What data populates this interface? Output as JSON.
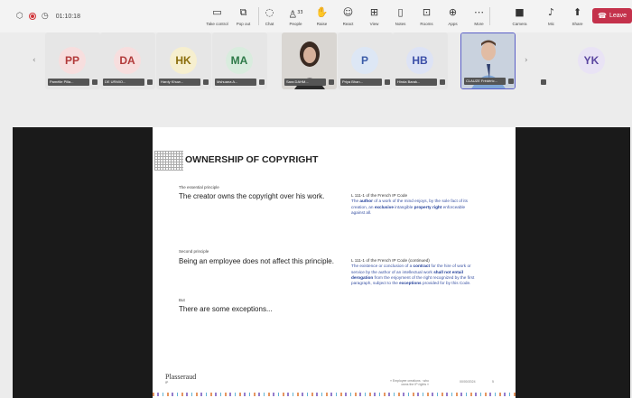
{
  "toolbar": {
    "timer": "01:10:18",
    "items": [
      {
        "label": "Take control",
        "icon": "take-control-icon"
      },
      {
        "label": "Pop out",
        "icon": "pop-out-icon"
      },
      {
        "label": "Chat",
        "icon": "chat-icon"
      },
      {
        "label": "People",
        "icon": "people-icon",
        "badge": "33"
      },
      {
        "label": "Raise",
        "icon": "raise-hand-icon"
      },
      {
        "label": "React",
        "icon": "react-icon"
      },
      {
        "label": "View",
        "icon": "view-icon"
      },
      {
        "label": "Notes",
        "icon": "notes-icon"
      },
      {
        "label": "Rooms",
        "icon": "rooms-icon"
      },
      {
        "label": "Apps",
        "icon": "apps-icon"
      },
      {
        "label": "More",
        "icon": "more-icon"
      },
      {
        "label": "Camera",
        "icon": "camera-icon"
      },
      {
        "label": "Mic",
        "icon": "mic-icon"
      },
      {
        "label": "Share",
        "icon": "share-icon"
      }
    ],
    "leave_label": "Leave"
  },
  "participants": [
    {
      "initials": "PP",
      "name": "Pamélie Pilla...",
      "bg": "#f7dede",
      "fg": "#b23a3a"
    },
    {
      "initials": "DA",
      "name": "DE URMIO...",
      "bg": "#f7dede",
      "fg": "#b23a3a"
    },
    {
      "initials": "HK",
      "name": "Hardy Khuw...",
      "bg": "#f6efcf",
      "fg": "#8a6d0b"
    },
    {
      "initials": "MA",
      "name": "Mshuana A...",
      "bg": "#d9ecde",
      "fg": "#2e7a48"
    },
    {
      "initials": "",
      "name": "Sara DAHM...",
      "video": true
    },
    {
      "initials": "P",
      "name": "Priya Bhan...",
      "bg": "#dde7f5",
      "fg": "#3b5ca8"
    },
    {
      "initials": "HB",
      "name": "Hinda Barak...",
      "bg": "#dde3f5",
      "fg": "#3b4ea8"
    },
    {
      "initials": "",
      "name": "CLAUZE Frédéric...",
      "video": true,
      "highlight": true
    },
    {
      "initials": "YK",
      "name": "",
      "bg": "#e9e3f5",
      "fg": "#5b46a0"
    }
  ],
  "slide": {
    "title": "OWNERSHIP OF COPYRIGHT",
    "principle1_label": "The essential principle",
    "principle1_text": "The creator owns the copyright over his work.",
    "quote1_ref": "L 111-1 of the French IP Code",
    "quote1_a": "The ",
    "quote1_b": "author",
    "quote1_c": " of a work of the mind enjoys, by the sole fact of its creation, an ",
    "quote1_d": "exclusive",
    "quote1_e": " intangible ",
    "quote1_f": "property right",
    "quote1_g": " enforceable against all.",
    "principle2_label": "Second principle",
    "principle2_text": "Being an employee does not affect this principle.",
    "quote2_ref": "L 111-1 of the French IP Code (continued)",
    "quote2_a": "The existence or conclusion of a ",
    "quote2_b": "contract",
    "quote2_c": " for the hire of work or service by the author of an intellectual work ",
    "quote2_d": "shall not entail derogation",
    "quote2_e": " from the enjoyment of the right recognized by the first paragraph, subject to the ",
    "quote2_f": "exceptions",
    "quote2_g": " provided for by this Code.",
    "but_label": "But",
    "but_text": "There are some exceptions...",
    "footer_logo": "Plasseraud",
    "footer_logo_sub": "IP",
    "footer_meta_1": "« Employee creations : who",
    "footer_meta_2": "owns the IP rights »",
    "footer_date": "00/00/2024",
    "footer_page": "5"
  }
}
